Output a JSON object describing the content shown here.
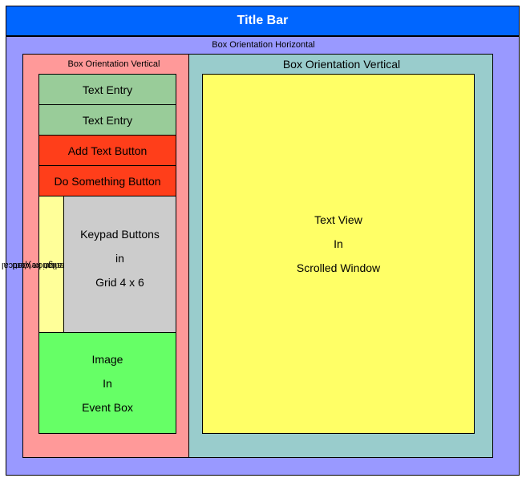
{
  "title_bar": "Title Bar",
  "outer_box": {
    "label": "Box Orientation Horizontal"
  },
  "left_box": {
    "label": "Box Orientation Vertical",
    "text_entry_1": "Text Entry",
    "text_entry_2": "Text Entry",
    "add_text_button": "Add Text Button",
    "do_something_button": "Do Something Button",
    "spacer": {
      "line1": "Box Orientation Vertical",
      "line2": "Spacer to align keypad"
    },
    "keypad": {
      "line1": "Keypad Buttons",
      "line2": "in",
      "line3": "Grid 4 x 6"
    },
    "image": {
      "line1": "Image",
      "line2": "In",
      "line3": "Event Box"
    }
  },
  "right_box": {
    "label": "Box Orientation Vertical",
    "text_view": {
      "line1": "Text View",
      "line2": "In",
      "line3": "Scrolled Window"
    }
  },
  "colors": {
    "title_bar": "#0066ff",
    "outer_box": "#9999ff",
    "left_box": "#ff9999",
    "right_box": "#99cccc",
    "text_entry": "#99cc99",
    "button": "#ff3e1a",
    "spacer": "#ffff99",
    "keypad": "#cccccc",
    "image_box": "#66ff66",
    "text_view": "#ffff66"
  }
}
